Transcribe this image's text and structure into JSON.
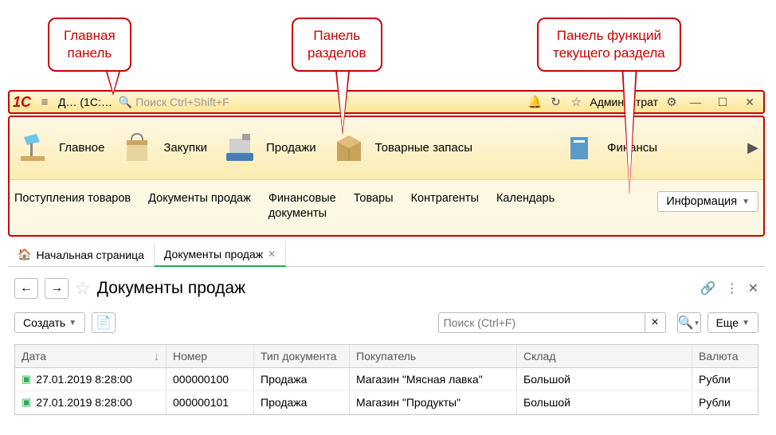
{
  "callouts": {
    "main_panel": "Главная\nпанель",
    "sections_panel": "Панель\nразделов",
    "functions_panel": "Панель функций\nтекущего раздела"
  },
  "titlebar": {
    "logo": "1C",
    "app_title": "Д… (1С:…",
    "search_placeholder": "Поиск Ctrl+Shift+F",
    "user_label": "Администрат"
  },
  "sections": [
    {
      "label": "Главное"
    },
    {
      "label": "Закупки"
    },
    {
      "label": "Продажи"
    },
    {
      "label": "Товарные запасы"
    },
    {
      "label": "Финансы"
    }
  ],
  "functions": [
    {
      "label": "Поступления товаров"
    },
    {
      "label": "Документы продаж"
    },
    {
      "label": "Финансовые\nдокументы"
    },
    {
      "label": "Товары"
    },
    {
      "label": "Контрагенты"
    },
    {
      "label": "Календарь"
    }
  ],
  "functions_info": "Информация",
  "tabs": {
    "home": "Начальная страница",
    "active": "Документы продаж"
  },
  "page": {
    "title": "Документы продаж",
    "create_btn": "Создать",
    "search_placeholder": "Поиск (Ctrl+F)",
    "more_btn": "Еще"
  },
  "table": {
    "columns": {
      "date": "Дата",
      "number": "Номер",
      "type": "Тип документа",
      "buyer": "Покупатель",
      "store": "Склад",
      "currency": "Валюта"
    },
    "rows": [
      {
        "date": "27.01.2019 8:28:00",
        "number": "000000100",
        "type": "Продажа",
        "buyer": "Магазин \"Мясная лавка\"",
        "store": "Большой",
        "currency": "Рубли"
      },
      {
        "date": "27.01.2019 8:28:00",
        "number": "000000101",
        "type": "Продажа",
        "buyer": "Магазин \"Продукты\"",
        "store": "Большой",
        "currency": "Рубли"
      }
    ]
  }
}
